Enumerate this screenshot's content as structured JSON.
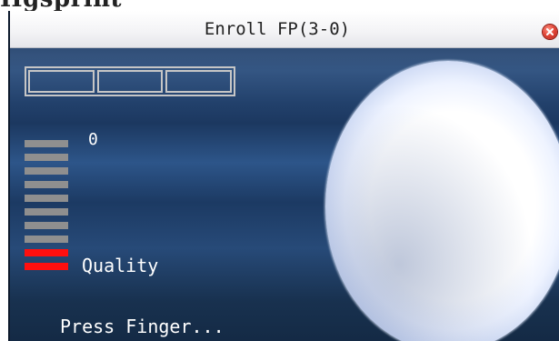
{
  "document": {
    "heading": "Hgsprint"
  },
  "screen": {
    "title": "Enroll FP(3-0)",
    "enroll_steps": {
      "total": 3,
      "completed": 0
    },
    "quality": {
      "value": "0",
      "label": "Quality",
      "segments_total": 10,
      "segments_active": 2,
      "segment_color": "#8f8f8f",
      "active_color": "#ff0f0f"
    },
    "status": "Press Finger...",
    "colors": {
      "background": "#1c3860",
      "title_bar": "#f4f4f6"
    },
    "icons": {
      "close": "close-icon",
      "finger_area": "fingerprint-placeholder"
    }
  }
}
